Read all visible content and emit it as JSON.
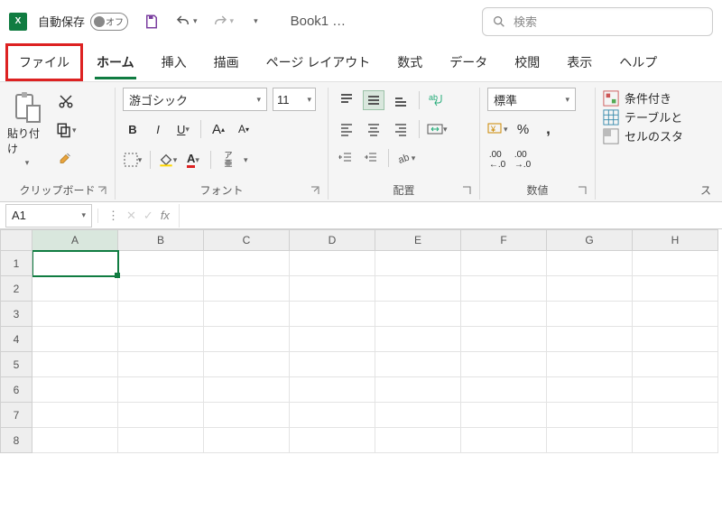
{
  "titlebar": {
    "autosave_label": "自動保存",
    "autosave_state": "オフ",
    "doc_name": "Book1",
    "doc_suffix": "…",
    "search_placeholder": "検索"
  },
  "tabs": {
    "file": "ファイル",
    "home": "ホーム",
    "insert": "挿入",
    "draw": "描画",
    "layout": "ページ レイアウト",
    "formulas": "数式",
    "data": "データ",
    "review": "校閲",
    "view": "表示",
    "help": "ヘルプ"
  },
  "ribbon": {
    "clipboard": {
      "paste": "貼り付け",
      "label": "クリップボード"
    },
    "font": {
      "name": "游ゴシック",
      "size": "11",
      "vert_text": "ア\n亜",
      "label": "フォント"
    },
    "align": {
      "label": "配置"
    },
    "number": {
      "format": "標準",
      "label": "数値"
    },
    "styles": {
      "cond": "条件付き",
      "table": "テーブルと",
      "cell": "セルのスタ",
      "label": "ス"
    }
  },
  "formula": {
    "namebox": "A1",
    "fx": "fx"
  },
  "grid": {
    "cols": [
      "A",
      "B",
      "C",
      "D",
      "E",
      "F",
      "G",
      "H"
    ],
    "rows": [
      "1",
      "2",
      "3",
      "4",
      "5",
      "6",
      "7",
      "8"
    ]
  }
}
